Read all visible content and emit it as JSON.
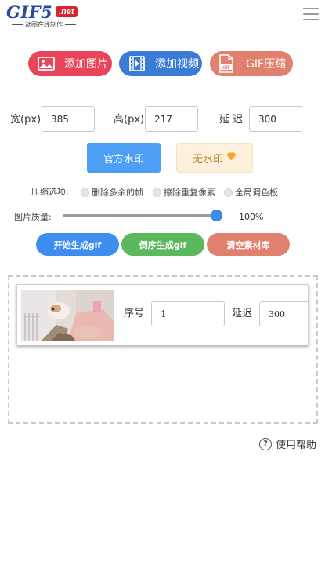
{
  "header": {
    "logo_main": "GIF5",
    "logo_net": ".net",
    "logo_sub": "动图在线制作"
  },
  "top_buttons": {
    "add_image": "添加图片",
    "add_video": "添加视频",
    "gif_compress": "GIF压缩",
    "gif_badge": "GIF"
  },
  "dimensions": {
    "width_label": "宽(px)",
    "width_value": "385",
    "height_label": "高(px)",
    "height_value": "217",
    "delay_label": "延 迟",
    "delay_value": "300"
  },
  "watermark": {
    "official": "官方水印",
    "none": "无水印",
    "none_icon": "diamond-icon"
  },
  "compress": {
    "label": "压缩选项:",
    "options": [
      "删除多余的帧",
      "擦除重复像素",
      "全局调色板"
    ]
  },
  "quality": {
    "label": "图片质量:",
    "value_text": "100%",
    "value": 1.0
  },
  "actions": {
    "start": "开始生成gif",
    "reverse": "倒序生成gif",
    "clear": "清空素材库"
  },
  "frame": {
    "seq_label": "序号",
    "seq_value": "1",
    "delay_label": "延迟",
    "delay_value": "300"
  },
  "help": {
    "label": "使用帮助"
  },
  "colors": {
    "red_button": "#e8455a",
    "blue_button": "#3a7bd5",
    "salmon_button": "#e0806f",
    "watermark_blue": "#4d9ff5",
    "green_button": "#5cb85c",
    "slider_thumb": "#3b8cf0"
  }
}
